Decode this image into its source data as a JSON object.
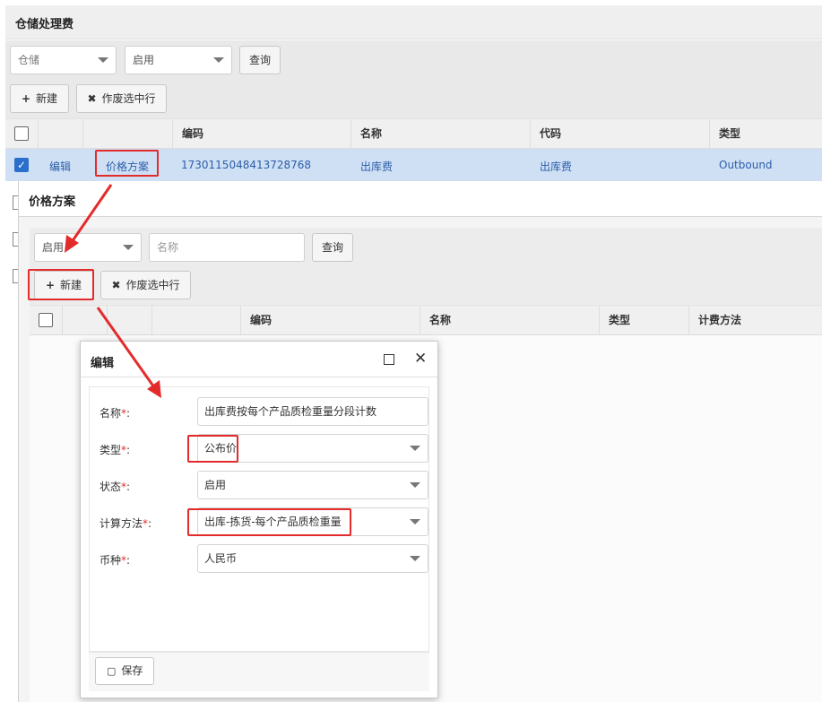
{
  "page": {
    "title": "仓储处理费",
    "filters": {
      "category_value": "仓储",
      "status_value": "启用",
      "query_label": "查询"
    },
    "toolbar": {
      "new_label": "新建",
      "void_label": "作废选中行"
    },
    "grid": {
      "columns": [
        "编码",
        "名称",
        "代码",
        "类型"
      ],
      "row": {
        "edit_label": "编辑",
        "price_plan_label": "价格方案",
        "code": "1730115048413728768",
        "name": "出库费",
        "code2": "出库费",
        "type": "Outbound"
      }
    }
  },
  "price_plan_dialog": {
    "title": "价格方案",
    "filters": {
      "status_value": "启用",
      "name_placeholder": "名称",
      "query_label": "查询"
    },
    "toolbar": {
      "new_label": "新建",
      "void_label": "作废选中行"
    },
    "grid": {
      "columns": [
        "编码",
        "名称",
        "类型",
        "计费方法"
      ]
    }
  },
  "edit_dialog": {
    "title": "编辑",
    "fields": {
      "name": {
        "label": "名称",
        "value": "出库费按每个产品质检重量分段计数"
      },
      "type": {
        "label": "类型",
        "value": "公布价"
      },
      "status": {
        "label": "状态",
        "value": "启用"
      },
      "calc_method": {
        "label": "计算方法",
        "value": "出库-拣货-每个产品质检重量"
      },
      "currency": {
        "label": "币种",
        "value": "人民币"
      }
    },
    "required_mark": "*",
    "colon": ":",
    "save_label": "保存"
  },
  "colors": {
    "highlight": "#e42b2b",
    "link": "#2d5ea8",
    "selection": "#cfe0f5",
    "checkbox": "#2a6fc9"
  },
  "icons": [
    "plus-icon",
    "times-icon",
    "check-icon",
    "maximize-icon",
    "close-icon",
    "save-icon",
    "caret-down-icon"
  ]
}
